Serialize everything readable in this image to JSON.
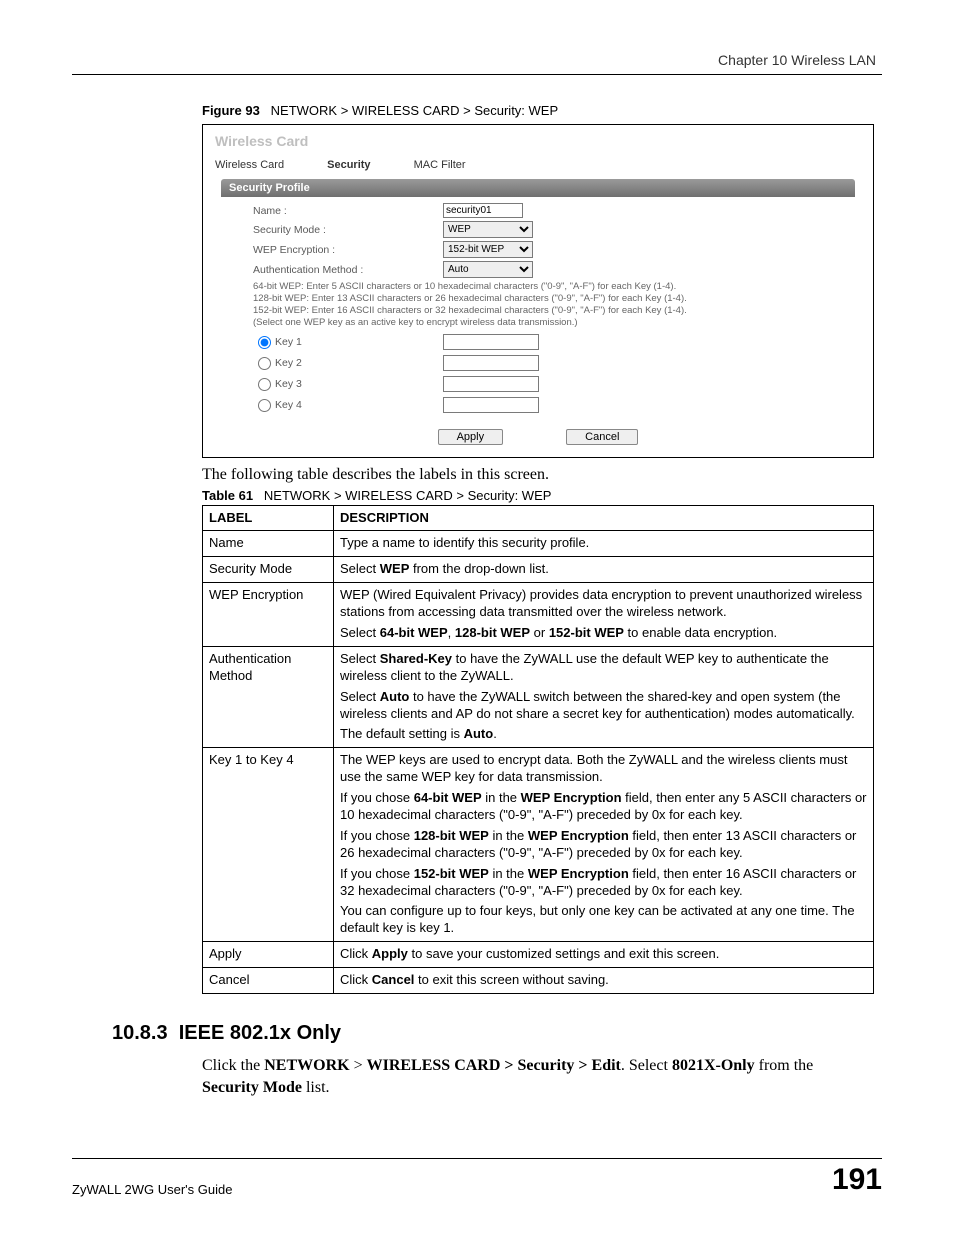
{
  "header": {
    "chapter": "Chapter 10 Wireless LAN"
  },
  "figure": {
    "label": "Figure 93",
    "caption": "NETWORK > WIRELESS CARD > Security: WEP"
  },
  "ui": {
    "title": "Wireless Card",
    "tabs": {
      "t1": "Wireless Card",
      "t2": "Security",
      "t3": "MAC Filter"
    },
    "profile_bar": "Security Profile",
    "labels": {
      "name": "Name :",
      "sec_mode": "Security Mode :",
      "wep_enc": "WEP Encryption :",
      "auth": "Authentication Method :"
    },
    "values": {
      "name": "security01",
      "sec_mode": "WEP",
      "wep_enc": "152-bit WEP",
      "auth": "Auto"
    },
    "help": {
      "l1": "64-bit WEP: Enter 5 ASCII characters or 10 hexadecimal characters (\"0-9\", \"A-F\") for each Key (1-4).",
      "l2": "128-bit WEP: Enter 13 ASCII characters or 26 hexadecimal characters (\"0-9\", \"A-F\") for each Key (1-4).",
      "l3": "152-bit WEP: Enter 16 ASCII characters or 32 hexadecimal characters (\"0-9\", \"A-F\") for each Key (1-4).",
      "l4": "(Select one WEP key as an active key to encrypt wireless data transmission.)"
    },
    "keys": {
      "k1": "Key 1",
      "k2": "Key 2",
      "k3": "Key 3",
      "k4": "Key 4"
    },
    "buttons": {
      "apply": "Apply",
      "cancel": "Cancel"
    }
  },
  "intro_text": "The following table describes the labels in this screen.",
  "table_caption": {
    "label": "Table 61",
    "caption": "NETWORK > WIRELESS CARD > Security: WEP"
  },
  "table": {
    "head": {
      "c1": "LABEL",
      "c2": "DESCRIPTION"
    },
    "rows": {
      "name": {
        "label": "Name",
        "desc": "Type a name to identify this security profile."
      },
      "secmode": {
        "label": "Security Mode",
        "desc_pre": "Select ",
        "desc_b1": "WEP",
        "desc_post": " from the drop-down list."
      },
      "wepenc": {
        "label": "WEP Encryption",
        "p1": "WEP (Wired Equivalent Privacy) provides data encryption to prevent unauthorized wireless stations from accessing data transmitted over the wireless network.",
        "p2_pre": "Select ",
        "p2_b64": "64-bit WEP",
        "p2_mid1": ", ",
        "p2_b128": "128-bit WEP",
        "p2_mid2": " or ",
        "p2_b152": "152-bit WEP",
        "p2_post": " to enable data encryption."
      },
      "auth": {
        "label": "Authentication Method",
        "p1_pre": "Select ",
        "p1_b": "Shared-Key",
        "p1_post": " to have the ZyWALL use the default WEP key to authenticate the wireless client to the ZyWALL.",
        "p2_pre": "Select ",
        "p2_b": "Auto",
        "p2_post": " to have the ZyWALL switch between the shared-key and open system (the wireless clients and AP do not share a secret key for authentication) modes automatically.",
        "p3_pre": "The default setting is ",
        "p3_b": "Auto",
        "p3_post": "."
      },
      "keys": {
        "label": "Key 1 to Key 4",
        "p1": "The WEP keys are used to encrypt data. Both the ZyWALL and the wireless clients must use the same WEP key for data transmission.",
        "p2_pre": "If you chose ",
        "p2_b1": "64-bit WEP",
        "p2_mid": " in the ",
        "p2_b2": "WEP Encryption",
        "p2_post": " field, then enter any 5 ASCII characters or 10 hexadecimal characters (\"0-9\", \"A-F\") preceded by 0x for each key.",
        "p3_pre": "If you chose ",
        "p3_b1": "128-bit WEP",
        "p3_mid": " in the ",
        "p3_b2": "WEP Encryption",
        "p3_post": " field, then enter 13 ASCII characters or 26 hexadecimal characters (\"0-9\", \"A-F\") preceded by 0x for each key.",
        "p4_pre": "If you chose ",
        "p4_b1": "152-bit WEP",
        "p4_mid": " in the ",
        "p4_b2": "WEP Encryption",
        "p4_post": " field, then enter 16 ASCII characters or 32 hexadecimal characters (\"0-9\", \"A-F\") preceded by 0x for each key.",
        "p5": "You can configure up to four keys, but only one key can be activated at any one time. The default key is key 1."
      },
      "apply": {
        "label": "Apply",
        "pre": "Click ",
        "b": "Apply",
        "post": " to save your customized settings and exit this screen."
      },
      "cancel": {
        "label": "Cancel",
        "pre": "Click ",
        "b": "Cancel",
        "post": " to exit this screen without saving."
      }
    }
  },
  "section": {
    "number": "10.8.3",
    "title": "IEEE 802.1x Only",
    "body_pre": "Click the ",
    "b1": "NETWORK",
    "mid1": " > ",
    "b2": "WIRELESS CARD > Security > Edit",
    "mid2": ". Select ",
    "b3": "8021X-Only",
    "mid3": " from the ",
    "b4": "Security Mode",
    "post": " list."
  },
  "footer": {
    "guide": "ZyWALL 2WG User's Guide",
    "page": "191"
  }
}
